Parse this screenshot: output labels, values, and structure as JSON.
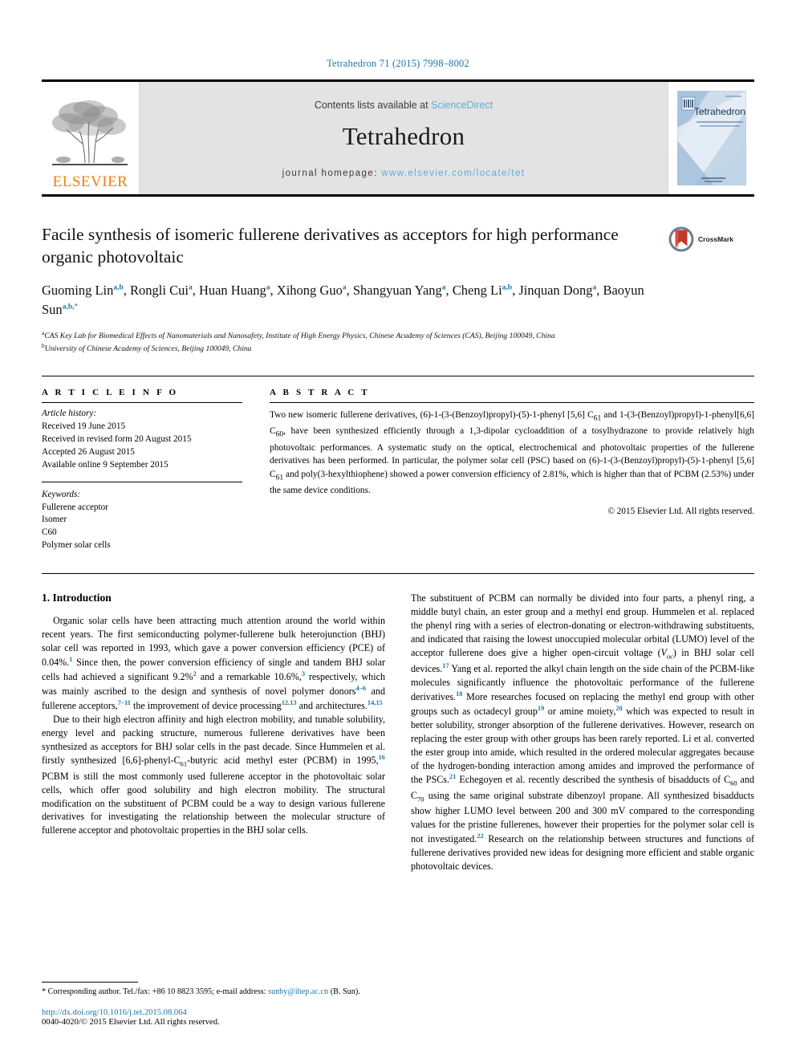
{
  "journal_ref": "Tetrahedron 71 (2015) 7998–8002",
  "masthead": {
    "publisher_name": "ELSEVIER",
    "contents_prefix": "Contents lists available at ",
    "contents_link": "ScienceDirect",
    "journal_name": "Tetrahedron",
    "homepage_prefix": "journal homepage: ",
    "homepage_link": "www.elsevier.com/locate/tet",
    "cover_title": "Tetrahedron"
  },
  "article": {
    "title": "Facile synthesis of isomeric fullerene derivatives as acceptors for high performance organic photovoltaic",
    "crossmark_label": "CrossMark",
    "authors_line1": "Guoming Lin",
    "authors_html": "Guoming Lin a,b, Rongli Cui a, Huan Huang a, Xihong Guo a, Shangyuan Yang a, Cheng Li a,b, Jinquan Dong a, Baoyun Sun a,b,*",
    "affiliation_a": "CAS Key Lab for Biomedical Effects of Nanomaterials and Nanosafety, Institute of High Energy Physics, Chinese Academy of Sciences (CAS), Beijing 100049, China",
    "affiliation_b": "University of Chinese Academy of Sciences, Beijing 100049, China"
  },
  "info": {
    "heading": "A R T I C L E   I N F O",
    "history_label": "Article history:",
    "history": [
      "Received 19 June 2015",
      "Received in revised form 20 August 2015",
      "Accepted 26 August 2015",
      "Available online 9 September 2015"
    ],
    "keywords_label": "Keywords:",
    "keywords": [
      "Fullerene acceptor",
      "Isomer",
      "C60",
      "Polymer solar cells"
    ]
  },
  "abstract": {
    "heading": "A B S T R A C T",
    "copyright": "© 2015 Elsevier Ltd. All rights reserved."
  },
  "sections": {
    "intro_heading": "1. Introduction"
  },
  "footer": {
    "corresponding": "* Corresponding author. Tel./fax: +86 10 8823 3595; e-mail address: ",
    "email": "sunby@ihep.ac.cn",
    "corresponding_tail": " (B. Sun).",
    "doi": "http://dx.doi.org/10.1016/j.tet.2015.08.064",
    "issn": "0040-4020/© 2015 Elsevier Ltd. All rights reserved."
  },
  "colors": {
    "link_blue": "#1b75a8",
    "sciencedirect_blue": "#5aaed8",
    "elsevier_orange": "#ef7f1a",
    "masthead_gray": "#e3e3e3"
  }
}
